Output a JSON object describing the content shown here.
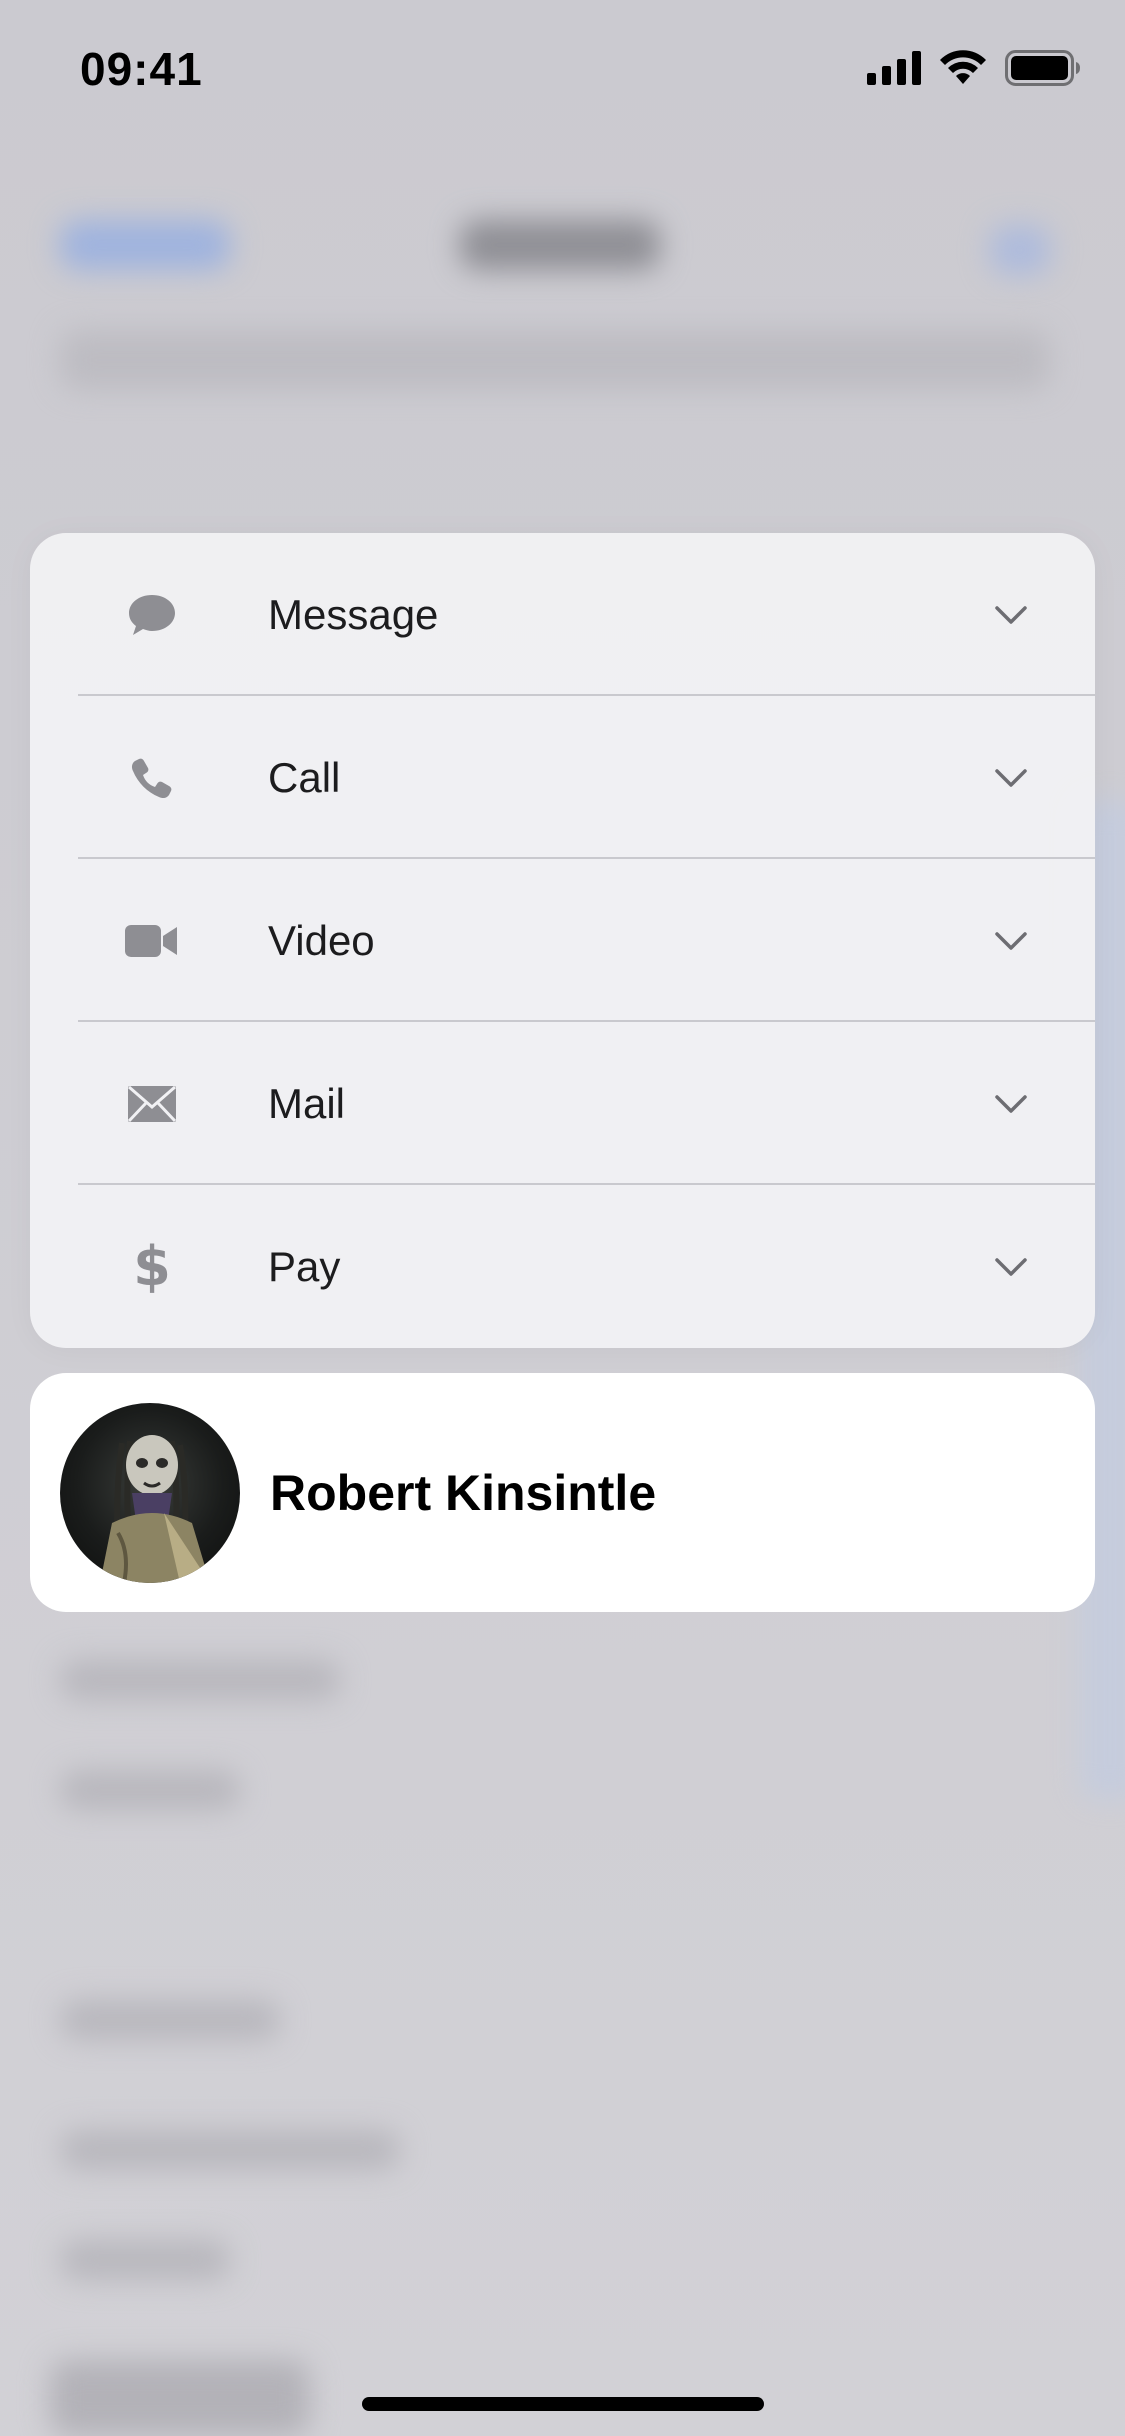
{
  "status_bar": {
    "time": "09:41"
  },
  "menu": {
    "items": [
      {
        "label": "Message",
        "icon": "message-bubble-icon"
      },
      {
        "label": "Call",
        "icon": "phone-icon"
      },
      {
        "label": "Video",
        "icon": "video-camera-icon"
      },
      {
        "label": "Mail",
        "icon": "envelope-icon"
      },
      {
        "label": "Pay",
        "icon": "dollar-sign-icon"
      }
    ]
  },
  "contact": {
    "name": "Robert Kinsintle"
  },
  "colors": {
    "icon_gray": "#8e8e93",
    "label": "#1c1c1e",
    "divider": "#c9c9ce"
  }
}
